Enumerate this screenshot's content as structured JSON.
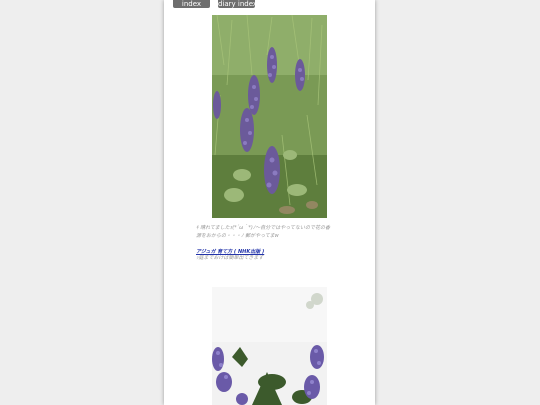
{
  "nav": {
    "index_label": "index",
    "diary_index_label": "diary index"
  },
  "post": {
    "caption_line1": "ｷ 晴れてましたｫ(*´ω｀*)ﾉ～自分ではやってないので花の香",
    "caption_line2": "源をおからの・・・ﾉ 郵がやってまw",
    "link_text": "アジュガ 育て方 ( NHK出版 )",
    "link_note": "ｯ庭までおけば簡単出てきます"
  },
  "photos": {
    "photo1_subject": "ajuga-flowers-photo",
    "photo2_subject": "ajuga-flowers-closeup-photo"
  }
}
